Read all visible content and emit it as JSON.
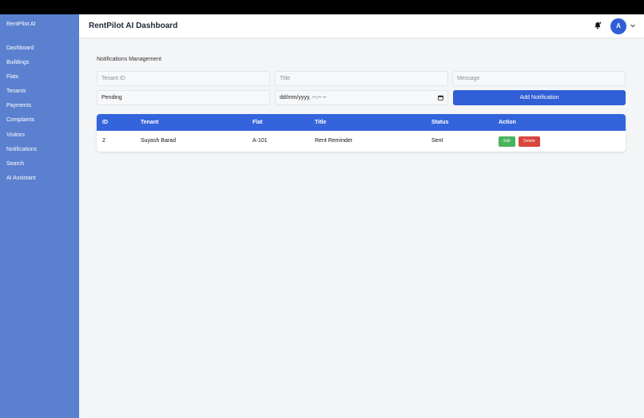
{
  "sidebar": {
    "brand": "RentPilot AI",
    "items": [
      {
        "label": "Dashboard"
      },
      {
        "label": "Buildings"
      },
      {
        "label": "Flats"
      },
      {
        "label": "Tenants"
      },
      {
        "label": "Payments"
      },
      {
        "label": "Complaints"
      },
      {
        "label": "Visitors"
      },
      {
        "label": "Notifications"
      },
      {
        "label": "Search"
      },
      {
        "label": "AI Assistant"
      }
    ]
  },
  "header": {
    "title": "RentPilot AI Dashboard",
    "avatar_initial": "A",
    "bell_icon": "bell-icon",
    "chevron_icon": "chevron-down-icon"
  },
  "main": {
    "section_title": "Notifications Management",
    "form": {
      "tenant_id_placeholder": "Tenant ID",
      "title_placeholder": "Title",
      "message_placeholder": "Message",
      "status_value": "Pending",
      "date_placeholder": "dd/mm/yyyy, --:-- --",
      "add_button": "Add Notification"
    },
    "table": {
      "columns": [
        "ID",
        "Tenant",
        "Flat",
        "Title",
        "Status",
        "Action"
      ],
      "rows": [
        {
          "id": "2",
          "tenant": "Suyash Barad",
          "flat": "A-101",
          "title": "Rent Reminder",
          "status": "Sent",
          "edit": "Edit",
          "delete": "Delete"
        }
      ]
    }
  },
  "colors": {
    "sidebar": "#5a80cf",
    "primary": "#2f5ed6",
    "table_header": "#3464dc",
    "edit": "#48b45c",
    "delete": "#d9453d"
  }
}
